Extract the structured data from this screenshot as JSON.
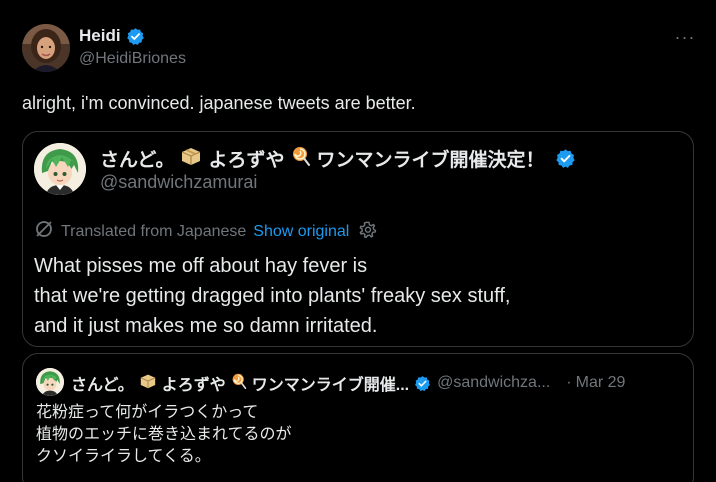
{
  "colors": {
    "background": "#000000",
    "text_primary": "#e7e9ea",
    "text_secondary": "#71767b",
    "link": "#1d9bf0",
    "verified_badge": "#1d9bf0",
    "border": "#333639"
  },
  "tweet": {
    "author_name": "Heidi",
    "author_handle": "@HeidiBriones",
    "more_icon": "more-horizontal-icon",
    "more_label": "···",
    "text": "alright, i'm convinced. japanese tweets are better."
  },
  "quote": {
    "author_name": "さんど。📦よろずや🍭 ワンマンライブ開催決定！",
    "author_name_parts": [
      "さんど。",
      "よろずや",
      " ワンマンライブ開催決定！"
    ],
    "author_handle": "@sandwichzamurai",
    "translated_label": "Translated from Japanese",
    "show_original_label": "Show original",
    "translated_icon": "translate-slash-icon",
    "settings_icon": "gear-icon",
    "body_lines": [
      "What pisses me off about hay fever is",
      "that we're getting dragged into plants' freaky sex stuff,",
      "and it just makes me so damn irritated."
    ]
  },
  "inner_quote": {
    "author_name_parts": [
      "さんど。",
      "よろずや",
      " ワンマンライブ開催..."
    ],
    "author_handle": "@sandwichza...",
    "separator": "·",
    "date": "Mar 29",
    "body_lines": [
      "花粉症って何がイラつくかって",
      "植物のエッチに巻き込まれてるのが",
      "クソイライラしてくる。"
    ]
  }
}
